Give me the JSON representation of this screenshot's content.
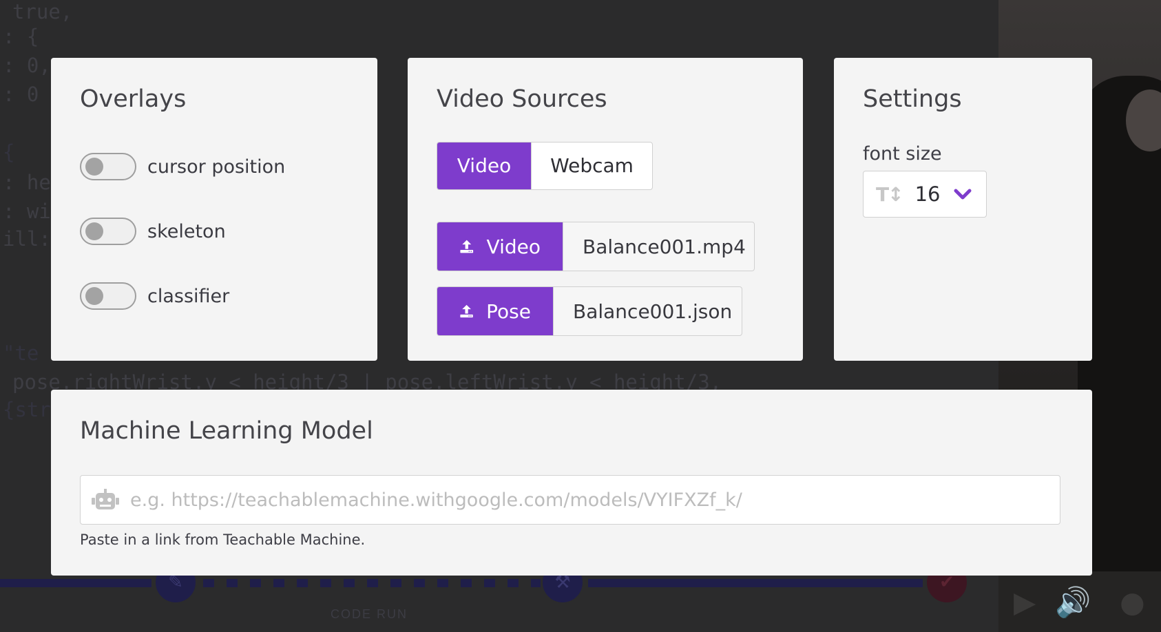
{
  "background": {
    "code_lines": [
      "true,",
      ": {",
      ": 0,",
      ": 0",
      "{",
      ": he",
      ": wi",
      "ill:",
      "\"te",
      "pose.rightWrist.y < height/3 | pose.leftWrist.y < height/3,",
      "{str"
    ],
    "timeline_label": "CODE RUN"
  },
  "overlays": {
    "title": "Overlays",
    "toggles": [
      {
        "label": "cursor position",
        "on": false
      },
      {
        "label": "skeleton",
        "on": false
      },
      {
        "label": "classifier",
        "on": false
      }
    ]
  },
  "video_sources": {
    "title": "Video Sources",
    "source_options": [
      "Video",
      "Webcam"
    ],
    "selected_source": "Video",
    "uploads": [
      {
        "button_label": "Video",
        "file_name": "Balance001.mp4"
      },
      {
        "button_label": "Pose",
        "file_name": "Balance001.json"
      }
    ]
  },
  "settings": {
    "title": "Settings",
    "font_size_label": "font size",
    "font_size_value": "16"
  },
  "ml_model": {
    "title": "Machine Learning Model",
    "url_value": "",
    "url_placeholder": "e.g. https://teachablemachine.withgoogle.com/models/VYIFXZf_k/",
    "help_text": "Paste in a link from Teachable Machine."
  },
  "colors": {
    "accent": "#7e3ccc",
    "panel_bg": "#f4f4f4",
    "backdrop": "#2b2b2c"
  }
}
